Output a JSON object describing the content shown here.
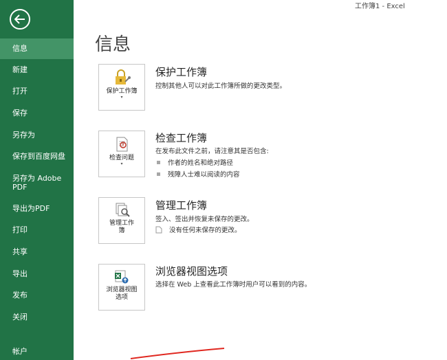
{
  "window": {
    "title": "工作簿1 - Excel"
  },
  "sidebar": {
    "back_label": "",
    "items": [
      {
        "label": "信息",
        "selected": true
      },
      {
        "label": "新建"
      },
      {
        "label": "打开"
      },
      {
        "label": "保存"
      },
      {
        "label": "另存为"
      },
      {
        "label": "保存到百度网盘"
      },
      {
        "label": "另存为 Adobe PDF"
      },
      {
        "label": "导出为PDF"
      },
      {
        "label": "打印"
      },
      {
        "label": "共享"
      },
      {
        "label": "导出"
      },
      {
        "label": "发布"
      },
      {
        "label": "关闭"
      },
      {
        "label": "帐户"
      }
    ]
  },
  "main": {
    "title": "信息",
    "sections": [
      {
        "button_label": "保护工作簿",
        "title": "保护工作簿",
        "description": "控制其他人可以对此工作簿所做的更改类型。"
      },
      {
        "button_label": "检查问题",
        "title": "检查工作簿",
        "description": "在发布此文件之前，请注意其是否包含:",
        "bullets": [
          "作者的姓名和绝对路径",
          "残障人士难以阅读的内容"
        ]
      },
      {
        "button_label": "管理工作簿",
        "title": "管理工作簿",
        "description": "签入、签出并恢复未保存的更改。",
        "note": "没有任何未保存的更改。"
      },
      {
        "button_label": "浏览器视图选项",
        "title": "浏览器视图选项",
        "description": "选择在 Web 上查看此工作簿时用户可以看到的内容。"
      }
    ]
  },
  "colors": {
    "sidebar_bg": "#217346",
    "sidebar_selected": "#439467"
  }
}
